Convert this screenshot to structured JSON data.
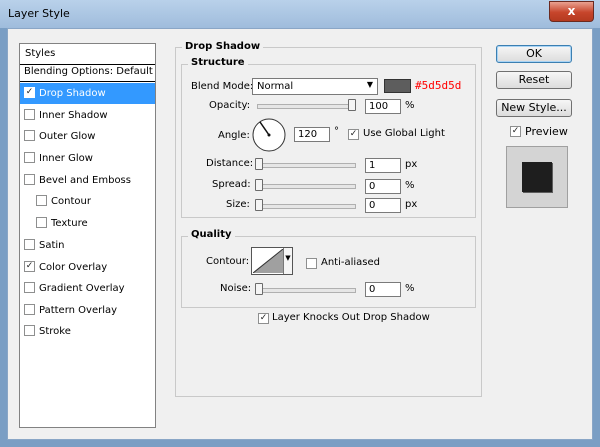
{
  "window": {
    "title": "Layer Style",
    "close_glyph": "x"
  },
  "styles_panel": {
    "header": "Styles",
    "items": [
      {
        "label": "Blending Options: Default",
        "checkbox": false,
        "checked": false,
        "selected": false
      },
      {
        "label": "Drop Shadow",
        "checkbox": true,
        "checked": true,
        "selected": true
      },
      {
        "label": "Inner Shadow",
        "checkbox": true,
        "checked": false,
        "selected": false
      },
      {
        "label": "Outer Glow",
        "checkbox": true,
        "checked": false,
        "selected": false
      },
      {
        "label": "Inner Glow",
        "checkbox": true,
        "checked": false,
        "selected": false
      },
      {
        "label": "Bevel and Emboss",
        "checkbox": true,
        "checked": false,
        "selected": false
      },
      {
        "label": "Contour",
        "checkbox": true,
        "checked": false,
        "selected": false,
        "indent": true
      },
      {
        "label": "Texture",
        "checkbox": true,
        "checked": false,
        "selected": false,
        "indent": true
      },
      {
        "label": "Satin",
        "checkbox": true,
        "checked": false,
        "selected": false
      },
      {
        "label": "Color Overlay",
        "checkbox": true,
        "checked": true,
        "selected": false
      },
      {
        "label": "Gradient Overlay",
        "checkbox": true,
        "checked": false,
        "selected": false
      },
      {
        "label": "Pattern Overlay",
        "checkbox": true,
        "checked": false,
        "selected": false
      },
      {
        "label": "Stroke",
        "checkbox": true,
        "checked": false,
        "selected": false
      }
    ]
  },
  "drop_shadow": {
    "title": "Drop Shadow",
    "structure": {
      "title": "Structure",
      "blend_mode_label": "Blend Mode:",
      "blend_mode_value": "Normal",
      "color_hex": "#5d5d5d",
      "opacity_label": "Opacity:",
      "opacity_value": "100",
      "opacity_unit": "%",
      "angle_label": "Angle:",
      "angle_value": "120",
      "angle_unit": "°",
      "use_global_light_label": "Use Global Light",
      "use_global_light_checked": true,
      "distance_label": "Distance:",
      "distance_value": "1",
      "distance_unit": "px",
      "spread_label": "Spread:",
      "spread_value": "0",
      "spread_unit": "%",
      "size_label": "Size:",
      "size_value": "0",
      "size_unit": "px"
    },
    "quality": {
      "title": "Quality",
      "contour_label": "Contour:",
      "anti_aliased_label": "Anti-aliased",
      "anti_aliased_checked": false,
      "noise_label": "Noise:",
      "noise_value": "0",
      "noise_unit": "%"
    },
    "knockout_label": "Layer Knocks Out Drop Shadow",
    "knockout_checked": true
  },
  "buttons": {
    "ok": "OK",
    "reset": "Reset",
    "new_style": "New Style..."
  },
  "preview": {
    "label": "Preview",
    "checked": true
  },
  "colors": {
    "accent": "#3399ff",
    "shadow_color": "#5d5d5d",
    "hex_text": "#ff0000"
  }
}
